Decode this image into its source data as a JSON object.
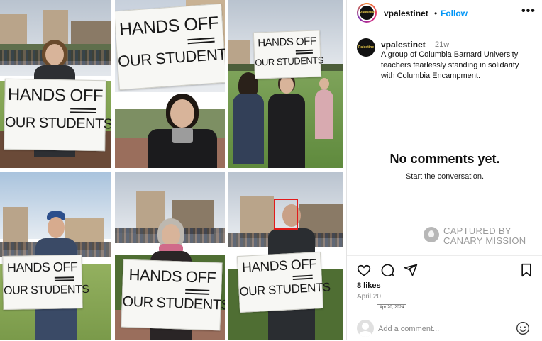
{
  "post": {
    "header": {
      "username": "vpalestinet",
      "separator": "•",
      "follow_label": "Follow",
      "more_icon": "more-horizontal-icon",
      "avatar_text": "Palestine"
    },
    "caption": {
      "username": "vpalestinet",
      "time_ago": "21w",
      "text": "A group of Columbia Barnard University teachers fearlessly standing in solidarity with Columbia Encampment."
    },
    "comments": {
      "empty_title": "No comments yet.",
      "empty_subtitle": "Start the conversation."
    },
    "watermark": {
      "line1": "CAPTURED BY",
      "line2": "CANARY MISSION"
    },
    "actions": {
      "icons": [
        "heart-icon",
        "comment-icon",
        "share-icon",
        "bookmark-icon"
      ],
      "likes": "8 likes",
      "date": "April 20",
      "date_tooltip": "Apr 20, 2024"
    },
    "comment_box": {
      "placeholder": "Add a comment...",
      "emoji_icon": "emoji-icon"
    }
  },
  "photos": {
    "sign_lines": [
      "HANDS OFF",
      "OUR STUDENTS"
    ]
  },
  "colors": {
    "follow_blue": "#0095f6",
    "highlight_red": "#e21b1b",
    "watermark_gray": "#9a9a9a"
  }
}
